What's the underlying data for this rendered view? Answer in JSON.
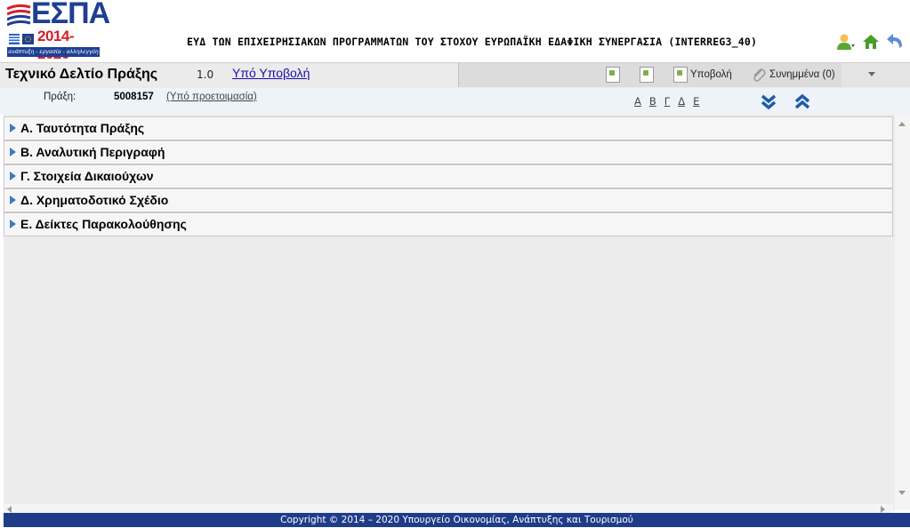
{
  "header": {
    "logo": {
      "brand": "ΕΣΠΑ",
      "years": "2014-2020",
      "motto": "ανάπτυξη - εργασία - αλληλεγγύη"
    },
    "title": "ΕΥΔ ΤΩΝ ΕΠΙΧΕΙΡΗΣΙΑΚΩΝ ΠΡΟΓΡΑΜΜΑΤΩΝ ΤΟΥ ΣΤΟΧΟΥ ΕΥΡΩΠΑΪΚΗ ΕΔΑΦΙΚΗ ΣΥΝΕΡΓΑΣΙΑ (INTERREG3_40)",
    "icons": [
      "user-icon",
      "home-icon",
      "logout-icon"
    ]
  },
  "toolbar": {
    "title": "Τεχνικό Δελτίο Πράξης",
    "version": "1.0",
    "status": "Υπό Υποβολή",
    "submit_label": "Υποβολή",
    "attachments_label": "Συνημμένα (0)"
  },
  "info": {
    "label": "Πράξη:",
    "code": "5008157",
    "stage": "(Υπό προετοιμασία)",
    "letters": [
      "Α",
      "Β",
      "Γ",
      "Δ",
      "Ε"
    ]
  },
  "sections": [
    {
      "label": "Α. Ταυτότητα Πράξης"
    },
    {
      "label": "Β. Αναλυτική Περιγραφή"
    },
    {
      "label": "Γ. Στοιχεία Δικαιούχων"
    },
    {
      "label": "Δ. Χρηματοδοτικό Σχέδιο"
    },
    {
      "label": "Ε. Δείκτες Παρακολούθησης"
    }
  ],
  "footer": {
    "text": "Copyright © 2014 – 2020 Υπουργείο Οικονομίας, Ανάπτυξης και Τουρισμού"
  },
  "colors": {
    "brand_blue": "#1d3f94",
    "brand_red": "#d71f26",
    "link": "#1a0dab",
    "footer_bg": "#1f3c88"
  }
}
